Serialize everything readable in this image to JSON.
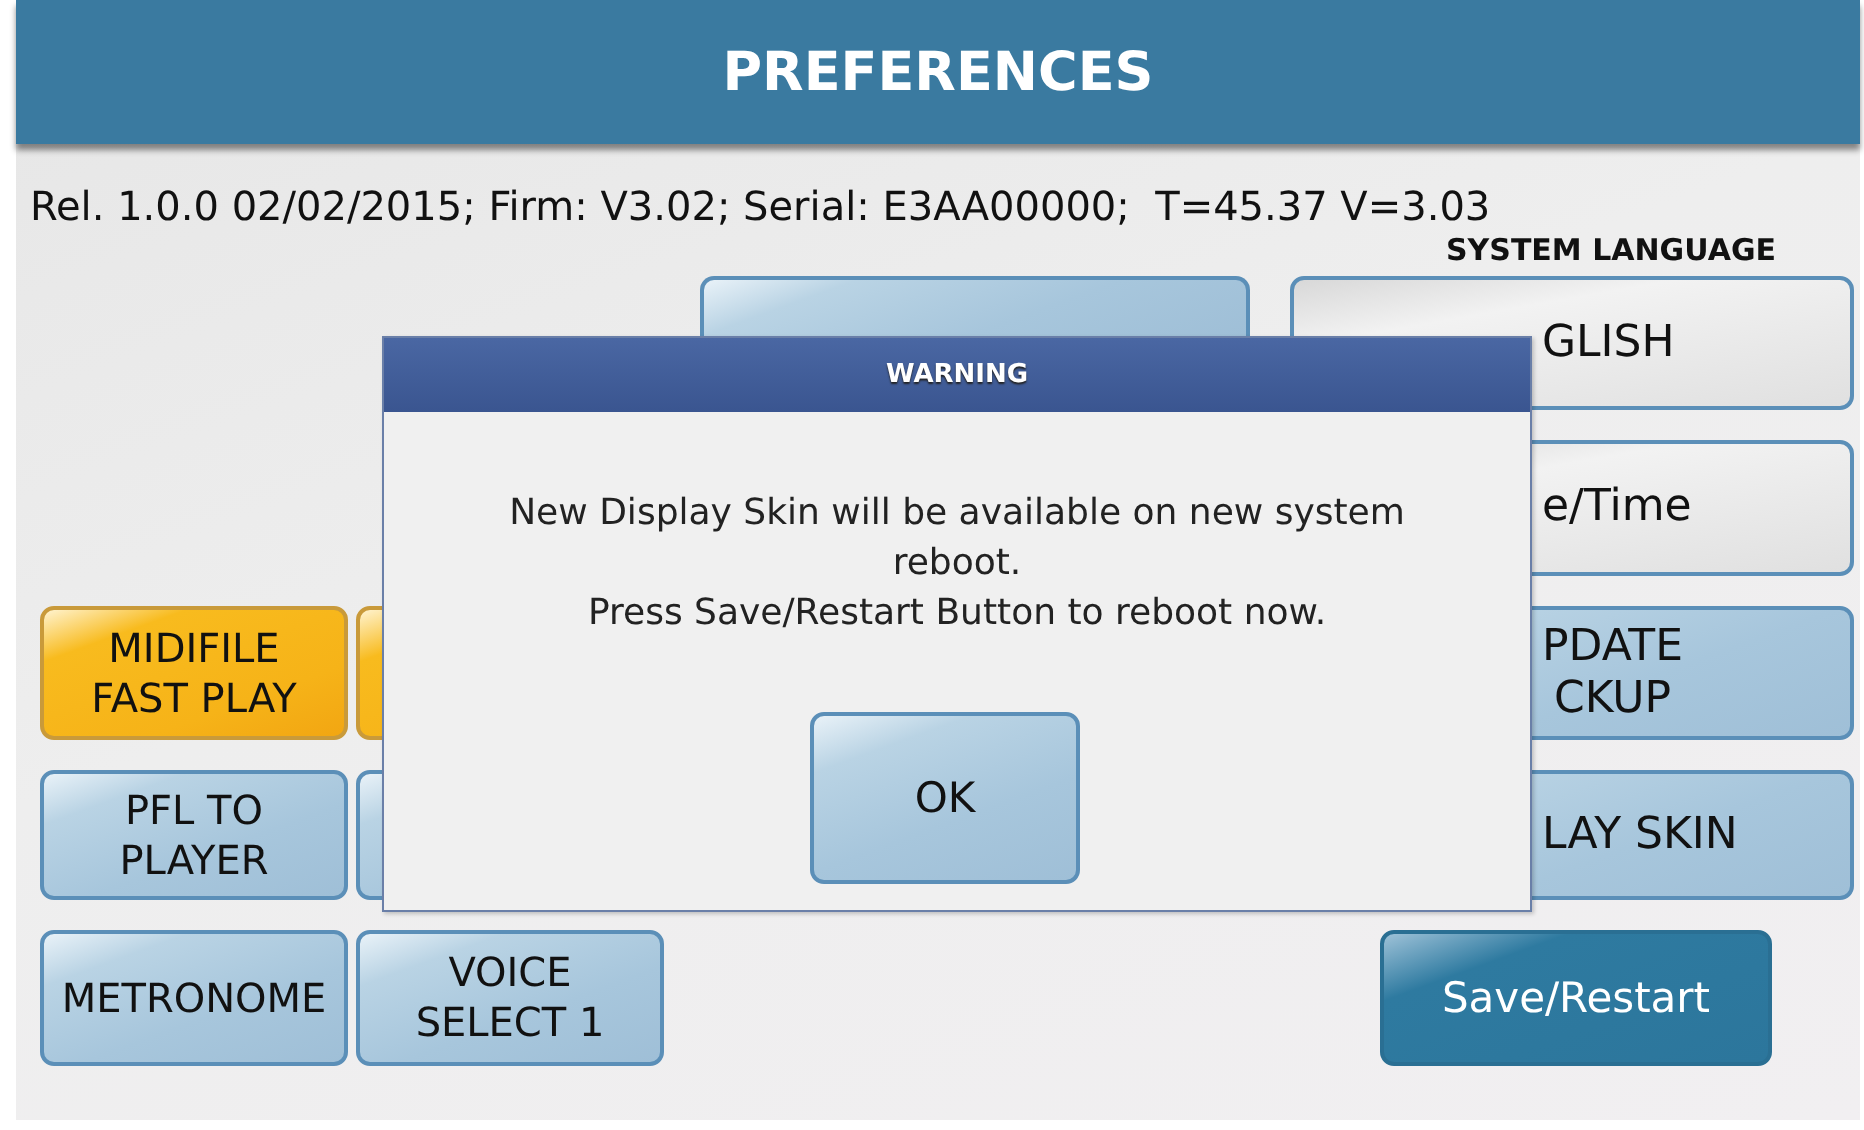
{
  "header": {
    "title": "PREFERENCES"
  },
  "info": "Rel. 1.0.0 02/02/2015; Firm: V3.02; Serial: E3AA00000;  T=45.37 V=3.03",
  "language_label": "SYSTEM LANGUAGE",
  "right_buttons": [
    {
      "kind": "selector",
      "lines": [
        "GLISH"
      ]
    },
    {
      "kind": "selector",
      "lines": [
        "e/Time"
      ]
    },
    {
      "kind": "action",
      "lines": [
        "PDATE",
        "CKUP"
      ]
    },
    {
      "kind": "action",
      "lines": [
        "LAY SKIN"
      ]
    }
  ],
  "left_buttons": [
    {
      "lines": [
        "MIDIFILE",
        "FAST PLAY"
      ],
      "on": true
    },
    {
      "on": true
    },
    {
      "lines": [
        "PFL TO",
        "PLAYER"
      ],
      "on": false
    },
    {
      "on": false
    },
    {
      "lines": [
        "METRONOME"
      ],
      "on": false
    },
    {
      "lines": [
        "VOICE",
        "SELECT 1"
      ],
      "on": false
    }
  ],
  "save_button": "Save/Restart",
  "dialog": {
    "title": "WARNING",
    "message": [
      "New Display Skin will be available on new system",
      "reboot.",
      "Press Save/Restart Button to reboot now."
    ],
    "button": "OK"
  }
}
